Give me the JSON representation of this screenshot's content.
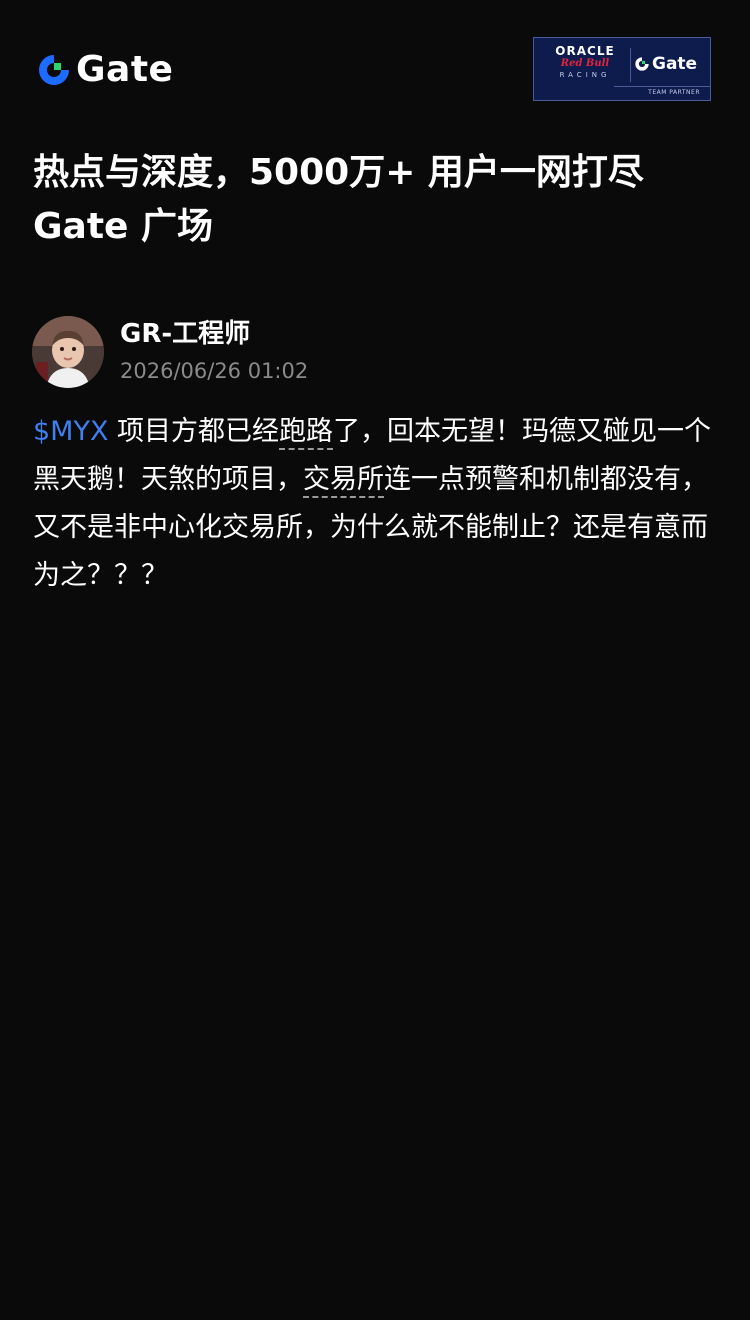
{
  "header": {
    "logo_text": "Gate",
    "partner": {
      "oracle": "ORACLE",
      "redbull": "Red Bull",
      "racing": "RACING",
      "gate": "Gate",
      "footer": "TEAM PARTNER"
    }
  },
  "headline": {
    "line1": "热点与深度，5000万+ 用户一网打尽",
    "line2": "Gate 广场"
  },
  "author": {
    "name": "GR-工程师",
    "time": "2026/06/26 01:02"
  },
  "post": {
    "ticker": "$MYX",
    "text_1": " 项目方都已经",
    "link_1": "跑路",
    "text_2": "了，回本无望！玛德又碰见一个黑天鹅！天煞的项目，",
    "link_2": "交易所",
    "text_3": "连一点预警和机制都没有，又不是非中心化交易所，为什么就不能制止？还是有意而为之？？？"
  },
  "colors": {
    "background": "#0a0a0a",
    "ticker": "#3f7ff0",
    "brand_green": "#2fd46e",
    "brand_blue": "#1e6bff",
    "badge_navy": "#0d1b4d"
  }
}
